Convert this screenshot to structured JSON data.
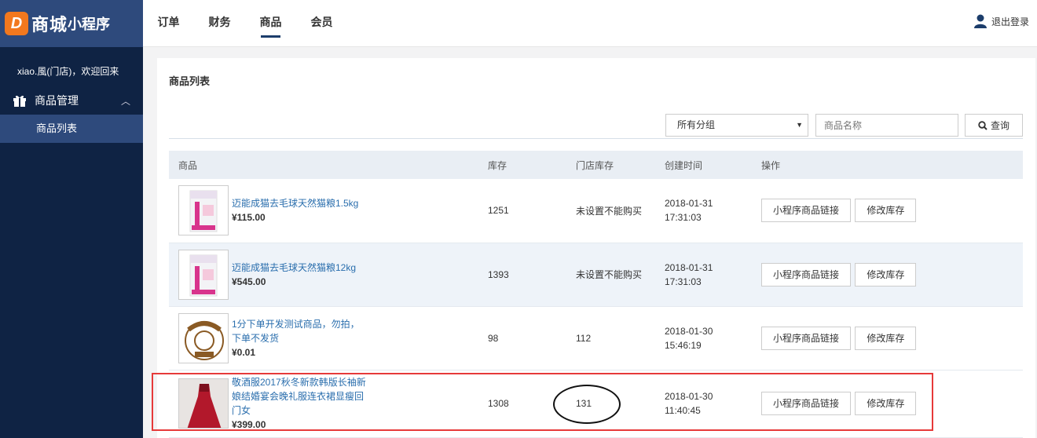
{
  "brand": {
    "badge": "D",
    "main": "商城",
    "sub": "小程序"
  },
  "sidebar": {
    "welcome": "xiao.風(门店)，欢迎回来",
    "menu_group": "商品管理",
    "menu_item": "商品列表"
  },
  "nav": {
    "items": [
      "订单",
      "财务",
      "商品",
      "会员"
    ],
    "active": "商品"
  },
  "header": {
    "logout": "退出登录"
  },
  "page": {
    "title": "商品列表",
    "filter": {
      "category_selected": "所有分组",
      "search_placeholder": "商品名称",
      "search_button": "查询"
    }
  },
  "table": {
    "columns": [
      "商品",
      "库存",
      "门店库存",
      "创建时间",
      "操作"
    ],
    "actions": {
      "link": "小程序商品链接",
      "edit_stock": "修改库存"
    },
    "rows": [
      {
        "name": "迈能成猫去毛球天然猫粮1.5kg",
        "price": "¥115.00",
        "stock": "1251",
        "store_stock": "未设置不能购买",
        "date": "2018-01-31",
        "time": "17:31:03"
      },
      {
        "name": "迈能成猫去毛球天然猫粮12kg",
        "price": "¥545.00",
        "stock": "1393",
        "store_stock": "未设置不能购买",
        "date": "2018-01-31",
        "time": "17:31:03"
      },
      {
        "name": "1分下单开发测试商品，勿拍，下单不发货",
        "price": "¥0.01",
        "stock": "98",
        "store_stock": "112",
        "date": "2018-01-30",
        "time": "15:46:19"
      },
      {
        "name": "敬酒服2017秋冬新款韩版长袖新娘结婚宴会晚礼服连衣裙显瘦回门女",
        "price": "¥399.00",
        "stock": "1308",
        "store_stock": "131",
        "date": "2018-01-30",
        "time": "11:40:45"
      }
    ]
  },
  "colors": {
    "sidebar": "#0f2344",
    "sidebar_active": "#2e4a7c",
    "accent_orange": "#f2781e",
    "link_blue": "#2a6ead",
    "highlight_red": "#e63a3a"
  }
}
